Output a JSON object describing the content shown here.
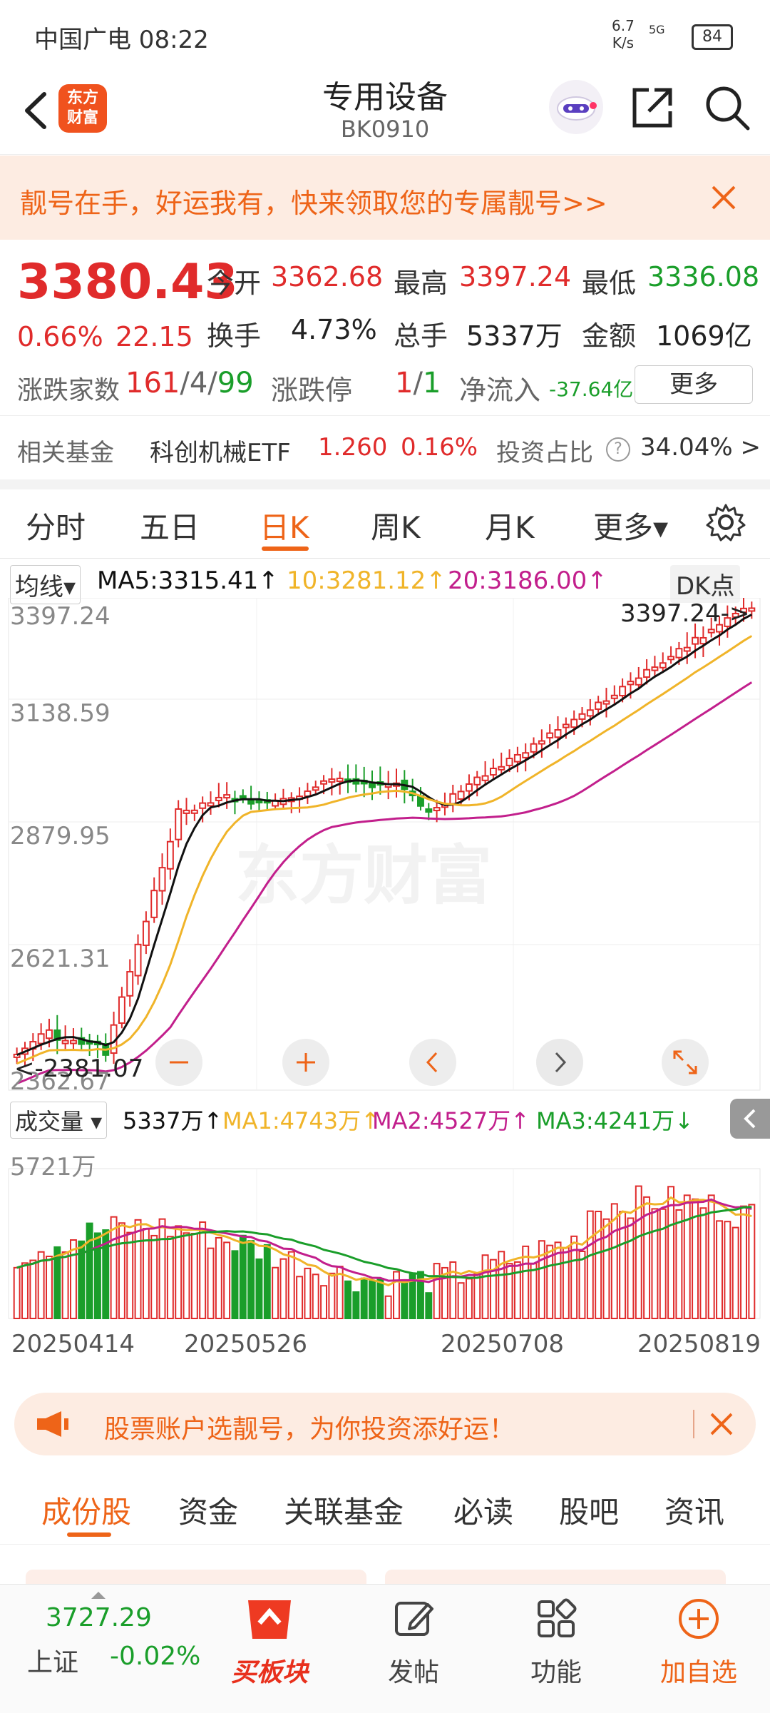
{
  "status": {
    "carrier": "中国广电 08:22",
    "speed_top": "6.7",
    "speed_bottom": "K/s",
    "network": "5G",
    "battery": "84"
  },
  "header": {
    "title": "专用设备",
    "code": "BK0910",
    "logo_line1": "东方",
    "logo_line2": "财富"
  },
  "banner": {
    "text": "靓号在手，好运我有，快来领取您的专属靓号>>"
  },
  "quote": {
    "price": "3380.43",
    "change_pct": "0.66%",
    "change": "22.15",
    "open_label": "今开",
    "open": "3362.68",
    "high_label": "最高",
    "high": "3397.24",
    "low_label": "最低",
    "low": "3336.08",
    "turnover_label": "换手",
    "turnover": "4.73%",
    "volume_label": "总手",
    "volume": "5337万",
    "amount_label": "金额",
    "amount": "1069亿",
    "breadth_label": "涨跌家数",
    "up": "161",
    "flat": "4",
    "down": "99",
    "sep": "/",
    "limit_label": "涨跌停",
    "limit_up": "1",
    "limit_down": "1",
    "netflow_label": "净流入",
    "netflow": "-37.64亿",
    "more": "更多"
  },
  "fund": {
    "label": "相关基金",
    "name": "科创机械ETF",
    "price": "1.260",
    "pct": "0.16%",
    "ratio_label": "投资占比",
    "ratio": "34.04% >"
  },
  "ktabs": [
    "分时",
    "五日",
    "日K",
    "周K",
    "月K",
    "更多▾"
  ],
  "kchart": {
    "ma_selector": "均线▾",
    "ma5": "MA5:3315.41↑",
    "ma10": "10:3281.12↑",
    "ma20": "20:3186.00↑",
    "dk": "DK点",
    "y_labels": [
      "3397.24",
      "3138.59",
      "2879.95",
      "2621.31",
      "2362.67"
    ],
    "high_marker": "3397.24->",
    "low_marker": "<-2381.07",
    "vol_selector": "成交量 ▾",
    "vol": "5337万↑",
    "vma1": "MA1:4743万↑",
    "vma2": "MA2:4527万↑",
    "vma3": "MA3:4241万↓",
    "vol_max": "5721万",
    "dates": [
      "20250414",
      "20250526",
      "20250708",
      "20250819"
    ],
    "watermark": "东方财富",
    "colors": {
      "up": "#e02b2b",
      "down": "#1a9e2a",
      "ma5": "#111111",
      "ma10": "#f0b429",
      "ma20": "#c21f8c"
    }
  },
  "ad2": {
    "text": "股票账户选靓号，为你投资添好运！"
  },
  "btabs": [
    "成份股",
    "资金",
    "关联基金",
    "必读",
    "股吧",
    "资讯"
  ],
  "nav": {
    "index_value": "3727.29",
    "index_name": "上证",
    "index_pct": "-0.02%",
    "buy": "买板块",
    "post": "发帖",
    "func": "功能",
    "add": "加自选"
  }
}
